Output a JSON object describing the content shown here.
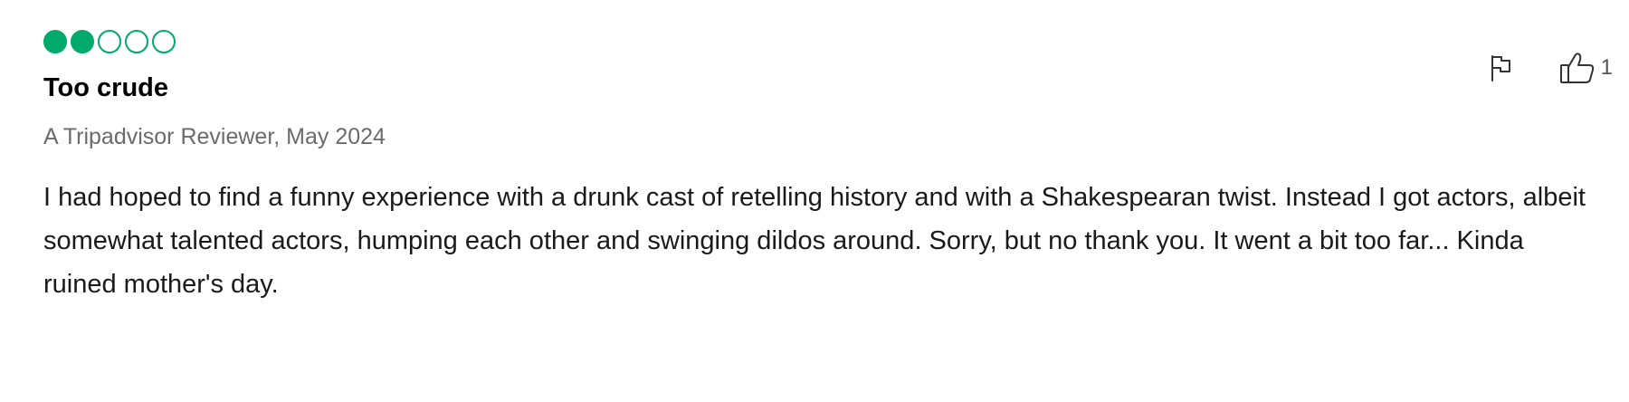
{
  "review": {
    "rating": {
      "value": 2,
      "max": 5,
      "filled_color": "#00aa6c"
    },
    "title": "Too crude",
    "author_date": "A Tripadvisor Reviewer, May 2024",
    "text": "I had hoped to find a funny experience with a drunk cast of retelling history and with a Shakespearan twist. Instead I got actors, albeit somewhat talented actors, humping each other and swinging dildos around. Sorry, but no thank you. It went a bit too far... Kinda ruined mother's day.",
    "actions": {
      "report_icon": "flag-icon",
      "helpful_icon": "thumbs-up-icon",
      "helpful_count": "1"
    }
  }
}
